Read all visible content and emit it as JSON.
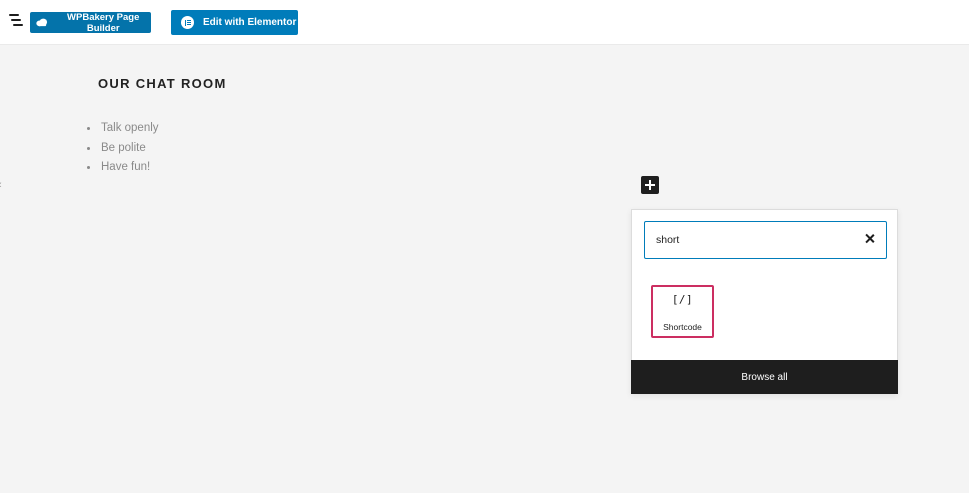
{
  "toolbar": {
    "wpbakery_label": "WPBakery Page Builder",
    "elementor_label": "Edit with Elementor"
  },
  "content": {
    "heading": "OUR CHAT ROOM",
    "list_items": [
      "Talk openly",
      "Be polite",
      "Have fun!"
    ]
  },
  "inserter": {
    "search_value": "short",
    "results": [
      {
        "icon_text": "[/]",
        "label": "Shortcode"
      }
    ],
    "browse_all_label": "Browse all"
  },
  "colors": {
    "accent": "#007cba",
    "wpbakery": "#0473aa",
    "selection": "#cc2e61",
    "dark": "#1e1e1e"
  },
  "icons": {
    "menu": "list-view-icon",
    "wpbakery": "cloud-icon",
    "elementor": "elementor-icon",
    "inserter": "plus-icon",
    "clear": "close-icon"
  }
}
